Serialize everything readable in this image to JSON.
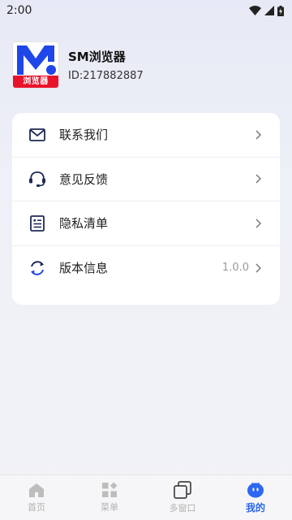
{
  "status_bar": {
    "time": "2:00"
  },
  "profile": {
    "logo_band_text": "浏览器",
    "app_name": "SM浏览器",
    "app_id": "ID:217882887"
  },
  "menu": {
    "items": [
      {
        "label": "联系我们",
        "icon": "mail-icon",
        "value": ""
      },
      {
        "label": "意见反馈",
        "icon": "headset-icon",
        "value": ""
      },
      {
        "label": "隐私清单",
        "icon": "document-list-icon",
        "value": ""
      },
      {
        "label": "版本信息",
        "icon": "refresh-icon",
        "value": "1.0.0"
      }
    ]
  },
  "bottom_nav": {
    "items": [
      {
        "label": "首页",
        "icon": "home-icon"
      },
      {
        "label": "菜单",
        "icon": "grid-menu-icon"
      },
      {
        "label": "多窗口",
        "icon": "windows-icon"
      },
      {
        "label": "我的",
        "icon": "profile-face-icon"
      }
    ]
  },
  "colors": {
    "accent": "#2c66f2",
    "brand_red": "#e8132b",
    "brand_blue": "#1f46e8"
  }
}
